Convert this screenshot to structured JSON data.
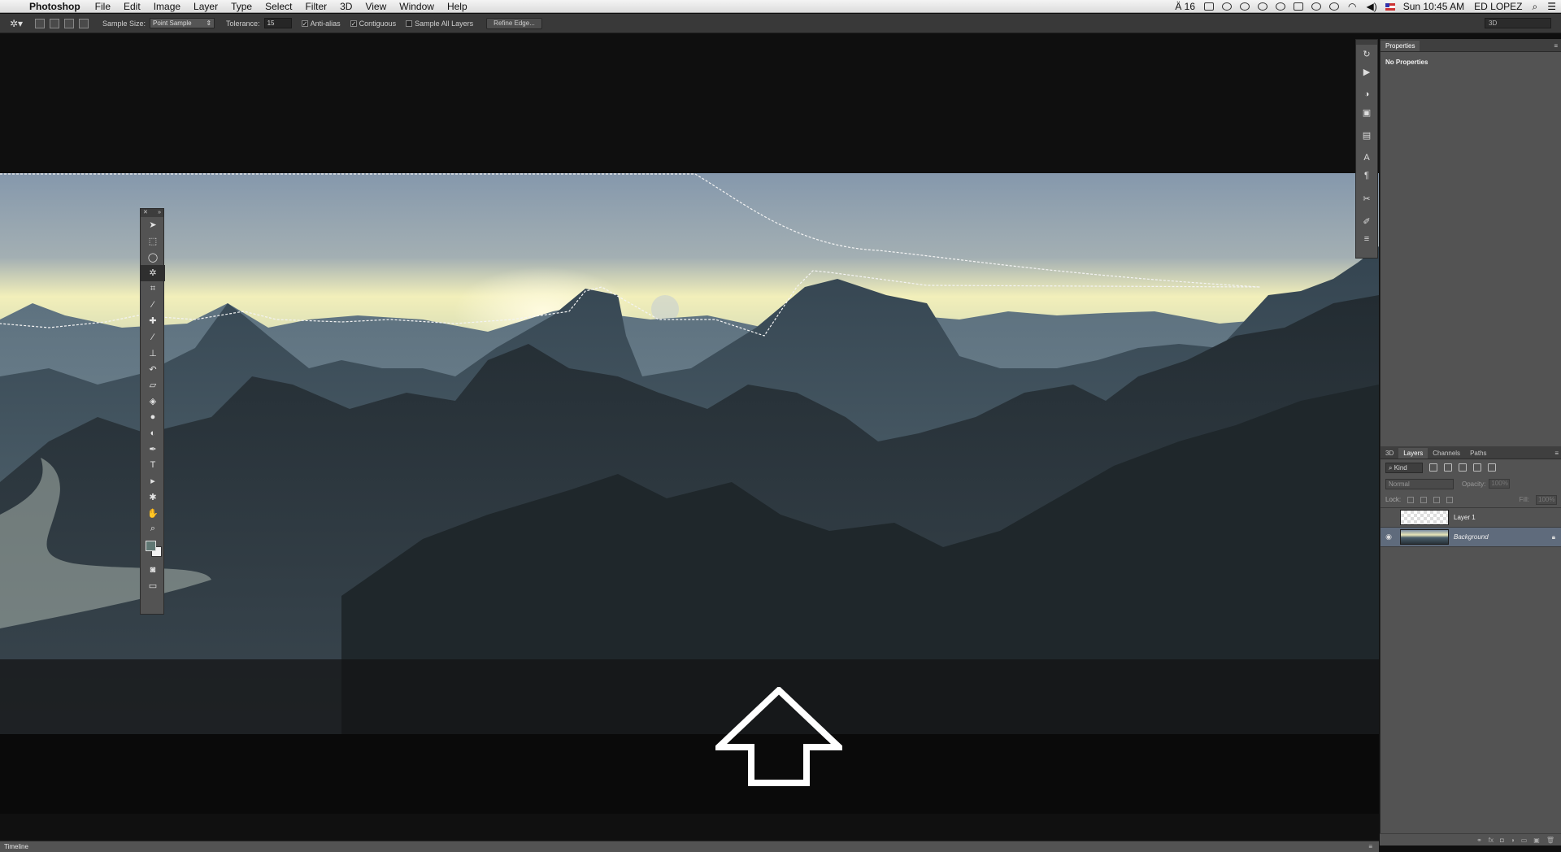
{
  "menubar": {
    "app_name": "Photoshop",
    "menus": [
      "File",
      "Edit",
      "Image",
      "Layer",
      "Type",
      "Select",
      "Filter",
      "3D",
      "View",
      "Window",
      "Help"
    ],
    "status_badge": "16",
    "clock": "Sun 10:45 AM",
    "user": "ED LOPEZ"
  },
  "options": {
    "sample_size_label": "Sample Size:",
    "sample_size_value": "Point Sample",
    "tolerance_label": "Tolerance:",
    "tolerance_value": "15",
    "anti_alias_label": "Anti-alias",
    "contiguous_label": "Contiguous",
    "sample_all_layers_label": "Sample All Layers",
    "refine_edge_label": "Refine Edge...",
    "workspace_value": "3D"
  },
  "properties": {
    "tab": "Properties",
    "body": "No Properties"
  },
  "layers": {
    "tabs": [
      "3D",
      "Layers",
      "Channels",
      "Paths"
    ],
    "active_tab": "Layers",
    "kind_filter": "Kind",
    "blend_mode": "Normal",
    "opacity_label": "Opacity:",
    "opacity_value": "100%",
    "lock_label": "Lock:",
    "fill_label": "Fill:",
    "fill_value": "100%",
    "items": [
      {
        "name": "Layer 1",
        "visible": false,
        "selected": false
      },
      {
        "name": "Background",
        "visible": true,
        "selected": true
      }
    ]
  },
  "timeline": {
    "label": "Timeline"
  },
  "colors": {
    "foreground_swatch": "#5f7773",
    "background_swatch": "#f2f2f2",
    "selected_layer": "#5f6b7c"
  },
  "toolbox_tools": [
    "move-tool",
    "marquee-tool",
    "lasso-tool",
    "magic-wand-tool",
    "crop-tool",
    "eyedropper-tool",
    "healing-brush-tool",
    "brush-tool",
    "clone-stamp-tool",
    "history-brush-tool",
    "eraser-tool",
    "paint-bucket-tool",
    "blur-tool",
    "dodge-tool",
    "pen-tool",
    "type-tool",
    "path-selection-tool",
    "shape-tool",
    "hand-tool",
    "zoom-tool"
  ]
}
